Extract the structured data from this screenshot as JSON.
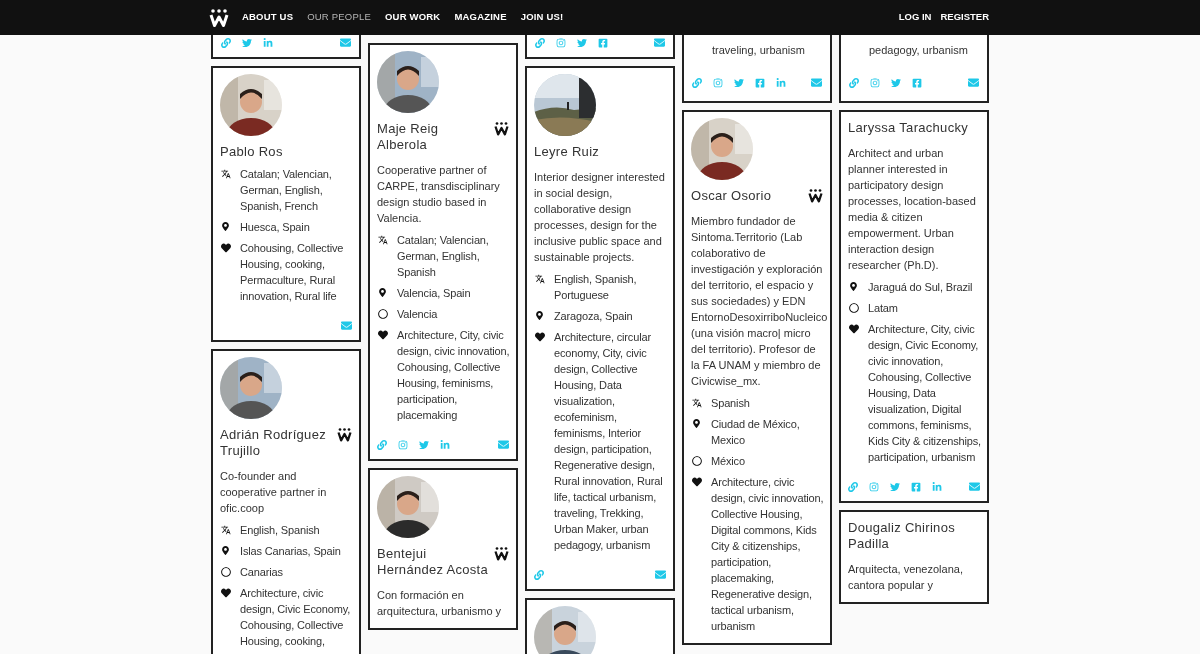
{
  "nav": {
    "items": [
      {
        "label": "ABOUT US",
        "selected": false
      },
      {
        "label": "OUR PEOPLE",
        "selected": true
      },
      {
        "label": "OUR WORK",
        "selected": false
      },
      {
        "label": "MAGAZINE",
        "selected": false
      },
      {
        "label": "JOIN US!",
        "selected": false
      }
    ],
    "account": [
      "LOG IN",
      "REGISTER"
    ]
  },
  "columns": [
    {
      "cards": [
        {
          "kind": "partial",
          "socials": [
            {
              "kind": "link"
            },
            {
              "kind": "twitter"
            },
            {
              "kind": "linkedin"
            },
            {
              "kind": "mail"
            }
          ]
        },
        {
          "kind": "profile",
          "avatar": {
            "kind": "picture"
          },
          "name": "Pablo Ros",
          "member": false,
          "details": [
            {
              "kind": "languages",
              "text": "Catalan; Valencian, German, English, Spanish, French"
            },
            {
              "kind": "location",
              "text": "Huesca, Spain"
            },
            {
              "kind": "interests",
              "text": "Cohousing, Collective Housing, cooking, Permaculture, Rural innovation, Rural life"
            }
          ],
          "socials": [
            {
              "kind": "mail"
            }
          ]
        },
        {
          "kind": "profile",
          "avatar": {
            "kind": "picture"
          },
          "name": "Adrián Rodríguez Trujillo",
          "member": true,
          "bio": "Co-founder and cooperative partner in ofic.coop",
          "details": [
            {
              "kind": "languages",
              "text": "English, Spanish"
            },
            {
              "kind": "location",
              "text": "Islas Canarias, Spain"
            },
            {
              "kind": "region",
              "text": "Canarias"
            },
            {
              "kind": "interests",
              "text": "Architecture, civic design, Civic Economy, Cohousing, Collective Housing, cooking,"
            }
          ]
        }
      ]
    },
    {
      "cards": [
        {
          "kind": "profile",
          "avatar": {
            "kind": "picture"
          },
          "name": "Maje Reig Alberola",
          "member": true,
          "bio": "Cooperative partner of CARPE, transdisciplinary design studio based in Valencia.",
          "details": [
            {
              "kind": "languages",
              "text": "Catalan; Valencian, German, English, Spanish"
            },
            {
              "kind": "location",
              "text": "Valencia, Spain"
            },
            {
              "kind": "region",
              "text": "Valencia"
            },
            {
              "kind": "interests",
              "text": "Architecture, City, civic design, civic innovation, Cohousing, Collective Housing, feminisms, participation, placemaking"
            }
          ],
          "socials": [
            {
              "kind": "link"
            },
            {
              "kind": "instagram"
            },
            {
              "kind": "twitter"
            },
            {
              "kind": "linkedin"
            },
            {
              "kind": "mail"
            }
          ]
        },
        {
          "kind": "profile",
          "avatar": {
            "kind": "picture"
          },
          "name": "Bentejui Hernández Acosta",
          "member": true,
          "bio": "Con formación en arquitectura, urbanismo y"
        }
      ]
    },
    {
      "cards": [
        {
          "kind": "partial",
          "socials": [
            {
              "kind": "link"
            },
            {
              "kind": "instagram"
            },
            {
              "kind": "twitter"
            },
            {
              "kind": "facebook"
            },
            {
              "kind": "mail"
            }
          ]
        },
        {
          "kind": "profile",
          "avatar": {
            "kind": "picture"
          },
          "name": "Leyre Ruiz",
          "member": false,
          "bio": "Interior designer interested in social design, collaborative design processes, design for the inclusive public space and sustainable projects.",
          "details": [
            {
              "kind": "languages",
              "text": "English, Spanish, Portuguese"
            },
            {
              "kind": "location",
              "text": "Zaragoza, Spain"
            },
            {
              "kind": "interests",
              "text": "Architecture, circular economy, City, civic design, Collective Housing, Data visualization, ecofeminism, feminisms, Interior design, participation, Regenerative design, Rural innovation, Rural life, tactical urbanism, traveling, Trekking, Urban Maker, urban pedagogy, urbanism"
            }
          ],
          "socials": [
            {
              "kind": "link"
            },
            {
              "kind": "mail"
            }
          ]
        },
        {
          "kind": "profile",
          "avatar": {
            "kind": "picture"
          }
        }
      ]
    },
    {
      "cards": [
        {
          "kind": "partial",
          "interests": "traveling, urbanism",
          "socials": [
            {
              "kind": "link"
            },
            {
              "kind": "instagram"
            },
            {
              "kind": "twitter"
            },
            {
              "kind": "facebook"
            },
            {
              "kind": "linkedin"
            },
            {
              "kind": "mail"
            }
          ]
        },
        {
          "kind": "profile",
          "avatar": {
            "kind": "picture"
          },
          "name": "Oscar Osorio",
          "member": true,
          "bio": "Miembro fundador de Sintoma.Territorio (Lab colaborativo de investigación y exploración del territorio, el espacio y sus sociedades) y EDN EntornoDesoxirriboNucleico (una visión macro| micro del territorio). Profesor de la FA UNAM y miembro de Civicwise_mx.",
          "details": [
            {
              "kind": "languages",
              "text": "Spanish"
            },
            {
              "kind": "location",
              "text": "Ciudad de México, Mexico"
            },
            {
              "kind": "region",
              "text": "México"
            },
            {
              "kind": "interests",
              "text": "Architecture, civic design, civic innovation, Collective Housing, Digital commons, Kids City & citizenships, participation, placemaking, Regenerative design, tactical urbanism, urbanism"
            }
          ]
        }
      ]
    },
    {
      "cards": [
        {
          "kind": "partial",
          "interests": "pedagogy, urbanism",
          "socials": [
            {
              "kind": "link"
            },
            {
              "kind": "instagram"
            },
            {
              "kind": "twitter"
            },
            {
              "kind": "facebook"
            },
            {
              "kind": "mail"
            }
          ]
        },
        {
          "kind": "profile",
          "name": "Laryssa Tarachucky",
          "member": false,
          "bio": "Architect and urban planner interested in participatory design processes, location-based media & citizen empowerment. Urban interaction design researcher (Ph.D).",
          "details": [
            {
              "kind": "location",
              "text": "Jaraguá do Sul, Brazil"
            },
            {
              "kind": "region",
              "text": "Latam"
            },
            {
              "kind": "interests",
              "text": "Architecture, City, civic design, Civic Economy, civic innovation, Cohousing, Collective Housing, Data visualization, Digital commons, feminisms, Kids City & citizenships, participation, urbanism"
            }
          ],
          "socials": [
            {
              "kind": "link"
            },
            {
              "kind": "instagram"
            },
            {
              "kind": "twitter"
            },
            {
              "kind": "facebook"
            },
            {
              "kind": "linkedin"
            },
            {
              "kind": "mail"
            }
          ]
        },
        {
          "kind": "profile",
          "name": "Dougaliz Chirinos Padilla",
          "member": false,
          "bio": "Arquitecta, venezolana, cantora popular y"
        }
      ]
    }
  ]
}
